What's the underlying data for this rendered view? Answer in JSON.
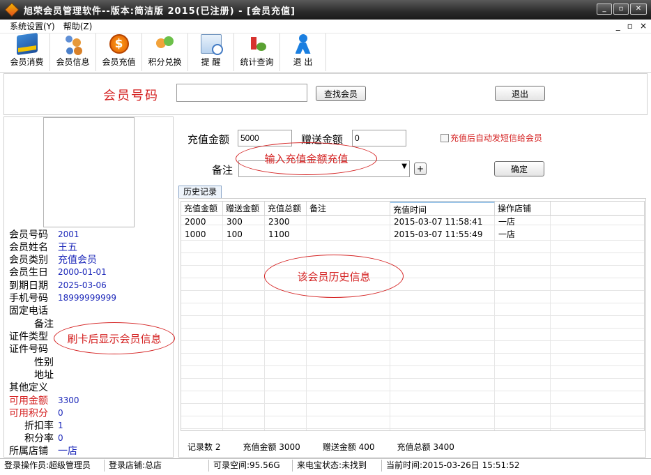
{
  "window": {
    "title": "旭荣会员管理软件--版本:简洁版 2015(已注册) - [会员充值]",
    "controls": [
      "_",
      "▫",
      "✕"
    ]
  },
  "menu": {
    "items": [
      "系统设置(Y)",
      "帮助(Z)"
    ],
    "mdi_controls": [
      "_",
      "▫",
      "×"
    ]
  },
  "toolbar": {
    "buttons": [
      {
        "label": "会员消费",
        "icon": "card-icon"
      },
      {
        "label": "会员信息",
        "icon": "people-icon"
      },
      {
        "label": "会员充值",
        "icon": "coin-icon"
      },
      {
        "label": "积分兑换",
        "icon": "exchange-icon"
      },
      {
        "label": "提  醒",
        "icon": "remind-icon"
      },
      {
        "label": "统计查询",
        "icon": "stats-icon"
      },
      {
        "label": "退  出",
        "icon": "exit-icon"
      }
    ]
  },
  "search": {
    "member_no_label": "会员号码",
    "member_no_value": "",
    "find_button": "查找会员",
    "exit_button": "退出"
  },
  "member_info": {
    "rows": [
      {
        "label": "会员号码",
        "value": "2001"
      },
      {
        "label": "会员姓名",
        "value": "王五"
      },
      {
        "label": "会员类别",
        "value": "充值会员"
      },
      {
        "label": "会员生日",
        "value": "2000-01-01"
      },
      {
        "label": "到期日期",
        "value": "2025-03-06"
      },
      {
        "label": "手机号码",
        "value": "18999999999"
      },
      {
        "label": "固定电话",
        "value": ""
      },
      {
        "label": "备注",
        "value": ""
      },
      {
        "label": "证件类型",
        "value": ""
      },
      {
        "label": "证件号码",
        "value": ""
      },
      {
        "label": "性别",
        "value": ""
      },
      {
        "label": "地址",
        "value": ""
      },
      {
        "label": "其他定义",
        "value": ""
      },
      {
        "label": "可用金额",
        "value": "3300"
      },
      {
        "label": "可用积分",
        "value": "0"
      },
      {
        "label": "折扣率",
        "value": "1"
      },
      {
        "label": "积分率",
        "value": "0"
      },
      {
        "label": "所属店铺",
        "value": "一店"
      }
    ],
    "annotation": "刷卡后显示会员信息"
  },
  "recharge": {
    "amount_label": "充值金额",
    "amount_value": "5000",
    "bonus_label": "赠送金额",
    "bonus_value": "0",
    "sms_label": "充值后自动发短信给会员",
    "remark_label": "备注",
    "remark_value": "",
    "plus_label": "+",
    "confirm_button": "确定",
    "annotation": "输入充值金额充值"
  },
  "history": {
    "tab_label": "历史记录",
    "columns": [
      "充值金额",
      "赠送金额",
      "充值总额",
      "备注",
      "充值时间",
      "操作店铺"
    ],
    "rows": [
      [
        "2000",
        "300",
        "2300",
        "",
        "2015-03-07 11:58:41",
        "一店"
      ],
      [
        "1000",
        "100",
        "1100",
        "",
        "2015-03-07 11:55:49",
        "一店"
      ]
    ],
    "annotation": "该会员历史信息",
    "summary": {
      "count": "记录数 2",
      "recharge": "充值金额 3000",
      "bonus": "赠送金额 400",
      "total": "充值总额 3400"
    }
  },
  "status": {
    "operator": "登录操作员:超级管理员",
    "store": "登录店铺:总店",
    "space": "可录空间:95.56G",
    "device": "来电宝状态:未找到",
    "time": "当前时间:2015-03-26日 15:51:52"
  },
  "colors": {
    "accent_red": "#d42020",
    "value_blue": "#1b27b9",
    "titlebar": "#2b2b2b"
  }
}
